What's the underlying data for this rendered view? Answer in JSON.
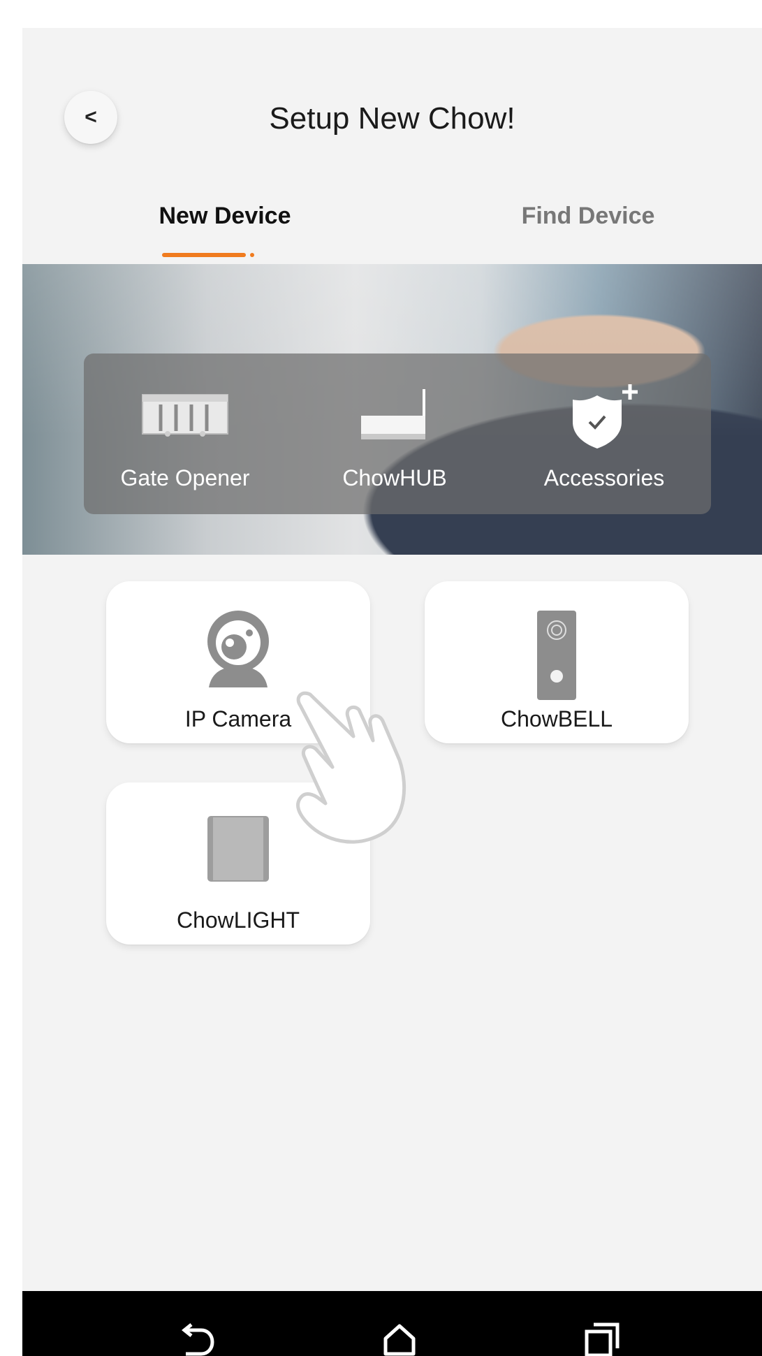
{
  "header": {
    "back_icon": "chevron-left-icon",
    "title": "Setup New Chow!"
  },
  "tabs": [
    {
      "label": "New Device",
      "active": true
    },
    {
      "label": "Find Device",
      "active": false
    }
  ],
  "accent_color": "#f07b1e",
  "hero": {
    "items": [
      {
        "label": "Gate Opener",
        "icon": "gate-opener-icon"
      },
      {
        "label": "ChowHUB",
        "icon": "hub-router-icon"
      },
      {
        "label": "Accessories",
        "icon": "shield-plus-icon"
      }
    ]
  },
  "devices": [
    {
      "label": "IP Camera",
      "icon": "ip-camera-icon"
    },
    {
      "label": "ChowBELL",
      "icon": "doorbell-icon"
    },
    {
      "label": "ChowLIGHT",
      "icon": "light-switch-icon"
    }
  ],
  "overlay": {
    "icon": "tap-hand-icon"
  },
  "navbar": {
    "items": [
      {
        "icon": "back-arrow-icon"
      },
      {
        "icon": "home-icon"
      },
      {
        "icon": "recents-icon"
      }
    ]
  }
}
